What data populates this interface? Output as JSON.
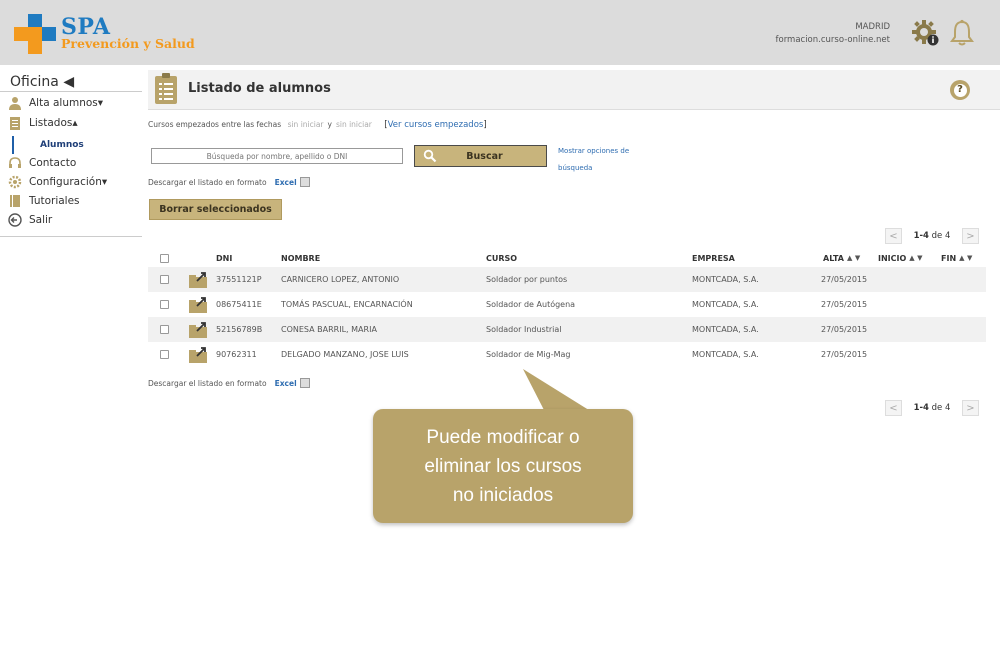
{
  "header": {
    "logo_title": "SPA",
    "logo_subtitle": "Prevención y Salud",
    "city": "MADRID",
    "site": "formacion.curso-online.net"
  },
  "sidebar": {
    "title": "Oficina ◀",
    "items": [
      {
        "label": "Alta alumnos▾",
        "icon": "user-icon"
      },
      {
        "label": "Listados▴",
        "icon": "list-icon"
      },
      {
        "label": "Contacto",
        "icon": "headset-icon"
      },
      {
        "label": "Configuración▾",
        "icon": "gear-icon"
      },
      {
        "label": "Tutoriales",
        "icon": "book-icon"
      },
      {
        "label": "Salir",
        "icon": "exit-icon"
      }
    ],
    "sub_item": "Alumnos"
  },
  "page": {
    "title": "Listado de alumnos"
  },
  "filter": {
    "prefix": "Cursos empezados entre las fechas",
    "from": "sin iniciar",
    "joiner": "y",
    "to": "sin iniciar",
    "link": "Ver cursos empezados"
  },
  "search": {
    "placeholder": "Búsqueda por nombre, apellido o DNI",
    "button_label": "Buscar",
    "more_options": "Mostrar opciones de búsqueda"
  },
  "download": {
    "label": "Descargar el listado en formato",
    "format": "Excel"
  },
  "delete_button": "Borrar seleccionados",
  "pager": {
    "range": "1-4",
    "of_label": "de",
    "total": "4"
  },
  "table": {
    "headers": {
      "dni": "DNI",
      "nombre": "NOMBRE",
      "curso": "CURSO",
      "empresa": "EMPRESA",
      "alta": "ALTA",
      "inicio": "INICIO",
      "fin": "FIN",
      "sort": "▲ ▼"
    },
    "rows": [
      {
        "dni": "37551121P",
        "nombre": "CARNICERO LOPEZ, ANTONIO",
        "curso": "Soldador por puntos",
        "empresa": "MONTCADA, S.A.",
        "alta": "27/05/2015",
        "inicio": "",
        "fin": ""
      },
      {
        "dni": "08675411E",
        "nombre": "TOMÁS PASCUAL, ENCARNACIÓN",
        "curso": "Soldador de Autógena",
        "empresa": "MONTCADA, S.A.",
        "alta": "27/05/2015",
        "inicio": "",
        "fin": ""
      },
      {
        "dni": "52156789B",
        "nombre": "CONESA BARRIL, MARIA",
        "curso": "Soldador Industrial",
        "empresa": "MONTCADA, S.A.",
        "alta": "27/05/2015",
        "inicio": "",
        "fin": ""
      },
      {
        "dni": "90762311",
        "nombre": "DELGADO MANZANO, JOSE LUIS",
        "curso": "Soldador de Mig-Mag",
        "empresa": "MONTCADA, S.A.",
        "alta": "27/05/2015",
        "inicio": "",
        "fin": ""
      }
    ]
  },
  "callout": {
    "lines": [
      "Puede modificar o",
      "eliminar los cursos",
      "no iniciados"
    ]
  },
  "colors": {
    "accent": "#c8b47c",
    "callout": "#b8a36a",
    "link": "#2f6db1",
    "brand_blue": "#1f7bc1",
    "brand_orange": "#f39a1e"
  }
}
